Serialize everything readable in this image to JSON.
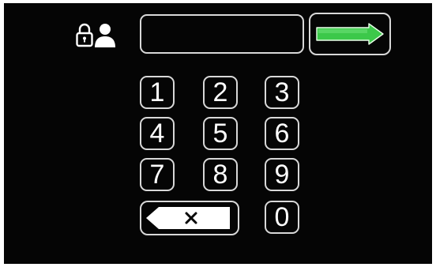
{
  "header": {
    "lock_user_icon": "lock-user-icon"
  },
  "pin_entry": {
    "value": ""
  },
  "enter_button": {
    "icon": "arrow-right-icon",
    "accent_color": "#3cc84a"
  },
  "keypad": {
    "keys": [
      "1",
      "2",
      "3",
      "4",
      "5",
      "6",
      "7",
      "8",
      "9",
      "0"
    ],
    "backspace_icon": "backspace-icon"
  },
  "theme": {
    "background": "#050505",
    "border": "#d8d8d8",
    "text": "#ffffff"
  }
}
